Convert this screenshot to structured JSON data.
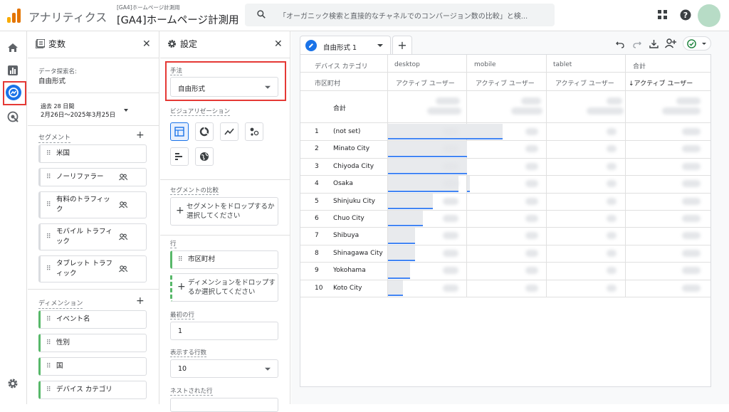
{
  "topbar": {
    "app_title": "アナリティクス",
    "property_small": "[GA4]ホームページ計測用",
    "property_big": "[GA4]ホームページ計測用",
    "search_text": "「オーガニック検索と直接的なチャネルでのコンバージョン数の比較」と検..."
  },
  "variables": {
    "title": "変数",
    "exploration_label": "データ探索名:",
    "exploration_name": "自由形式",
    "date_label": "過去 28 日間",
    "date_range": "2月26日～2025年3月25日",
    "segments_title": "セグメント",
    "segments": [
      "米国",
      "ノーリファラー",
      "有料のトラフィック",
      "モバイル トラフィック",
      "タブレット トラフィック"
    ],
    "dimensions_title": "ディメンション",
    "dimensions": [
      "イベント名",
      "性別",
      "国",
      "デバイス カテゴリ"
    ]
  },
  "settings": {
    "title": "設定",
    "technique_label": "手法",
    "technique_value": "自由形式",
    "visualization_label": "ビジュアリゼーション",
    "segment_compare_label": "セグメントの比較",
    "segment_drop_text": "セグメントをドロップするか選択してください",
    "rows_label": "行",
    "row_chip": "市区町村",
    "dimension_drop_text": "ディメンションをドロップするか選択してください",
    "first_row_label": "最初の行",
    "first_row_value": "1",
    "show_rows_label": "表示する行数",
    "show_rows_value": "10",
    "nested_rows_label": "ネストされた行"
  },
  "main": {
    "tab_label": "自由形式 1",
    "table": {
      "dim_header": "デバイス カテゴリ",
      "row_dim_header": "市区町村",
      "columns": [
        "desktop",
        "mobile",
        "tablet",
        "合計"
      ],
      "metric_label": "アクティブ ユーザー",
      "metric_label_sorted": "↓アクティブ ユーザー",
      "total_label": "合計",
      "rows": [
        {
          "n": "1",
          "city": "(not set)",
          "d": 1.0,
          "m": 0.45
        },
        {
          "n": "2",
          "city": "Minato City",
          "d": 1.0,
          "m": 0.0
        },
        {
          "n": "3",
          "city": "Chiyoda City",
          "d": 1.0,
          "m": 0.0
        },
        {
          "n": "4",
          "city": "Osaka",
          "d": 0.89,
          "m": 0.04
        },
        {
          "n": "5",
          "city": "Shinjuku City",
          "d": 0.57,
          "m": 0.0
        },
        {
          "n": "6",
          "city": "Chuo City",
          "d": 0.44,
          "m": 0.0
        },
        {
          "n": "7",
          "city": "Shibuya",
          "d": 0.34,
          "m": 0.0
        },
        {
          "n": "8",
          "city": "Shinagawa City",
          "d": 0.34,
          "m": 0.0
        },
        {
          "n": "9",
          "city": "Yokohama",
          "d": 0.28,
          "m": 0.0
        },
        {
          "n": "10",
          "city": "Koto City",
          "d": 0.19,
          "m": 0.0
        }
      ]
    }
  },
  "colors": {
    "accent": "#1a73e8",
    "highlight": "#e53935",
    "dimension_green": "#58b86a"
  }
}
